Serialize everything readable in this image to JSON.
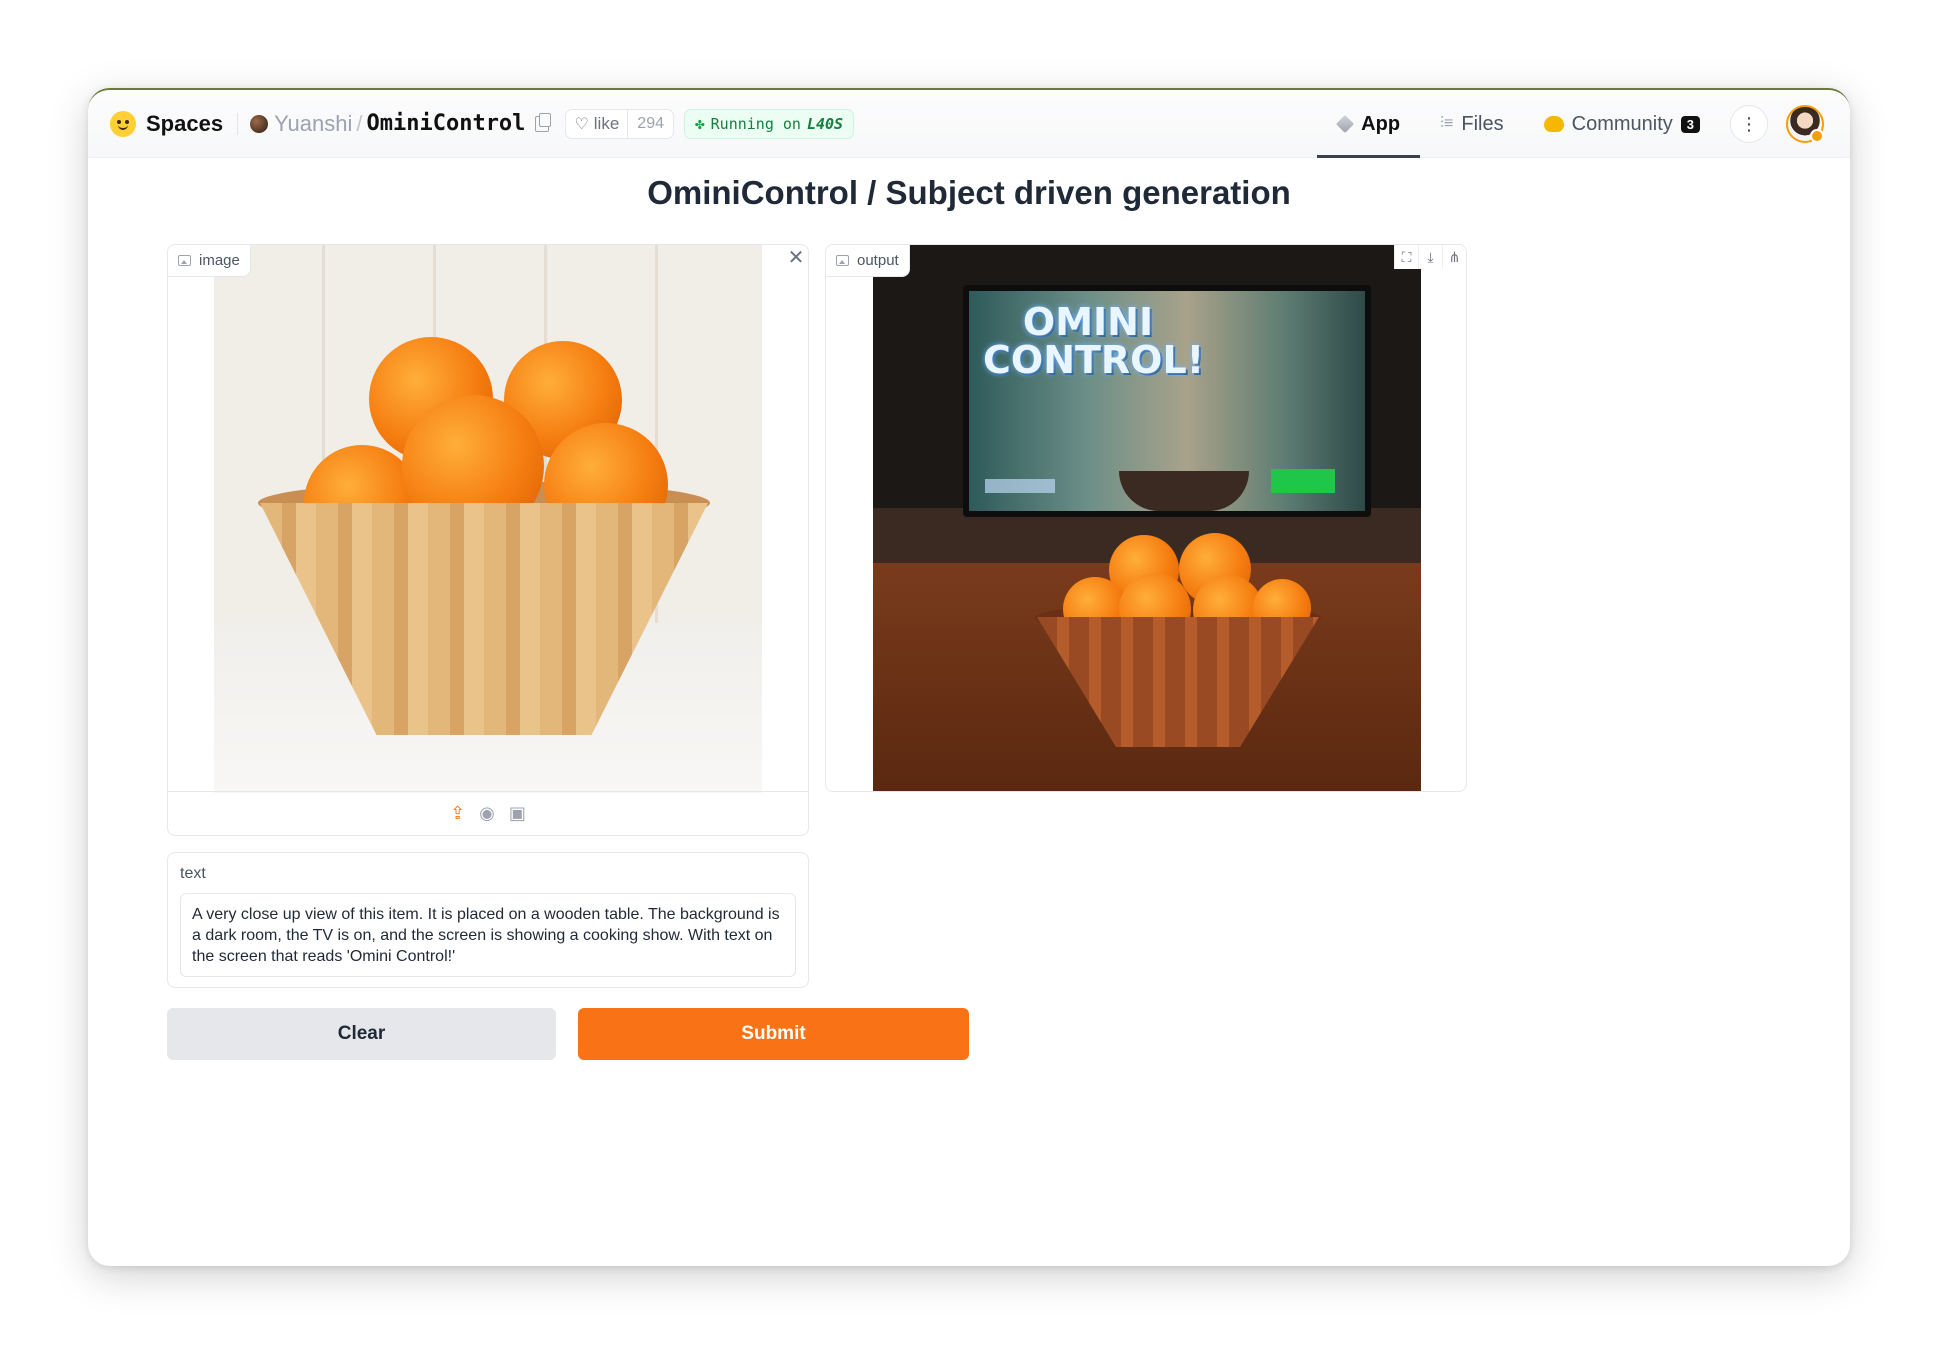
{
  "header": {
    "brand": "Spaces",
    "owner": "Yuanshi",
    "repo": "OminiControl",
    "like_label": "like",
    "like_count": "294",
    "status_prefix": "Running on",
    "status_hw": "L40S",
    "tabs": [
      {
        "label": "App",
        "icon": "app-cube-icon",
        "active": true
      },
      {
        "label": "Files",
        "icon": "files-icon",
        "active": false
      },
      {
        "label": "Community",
        "icon": "community-icon",
        "active": false,
        "badge": "3"
      }
    ]
  },
  "main": {
    "title": "OminiControl / Subject driven generation",
    "input_image": {
      "label": "image"
    },
    "output_image": {
      "label": "output",
      "overlay_text": "OMINI CONTROL!"
    },
    "text_input": {
      "label": "text",
      "value": "A very close up view of this item. It is placed on a wooden table. The background is a dark room, the TV is on, and the screen is showing a cooking show. With text on the screen that reads 'Omini Control!'"
    },
    "buttons": {
      "clear": "Clear",
      "submit": "Submit"
    }
  },
  "colors": {
    "accent": "#f97316",
    "status_green": "#15803d",
    "tab_underline": "#374151"
  }
}
